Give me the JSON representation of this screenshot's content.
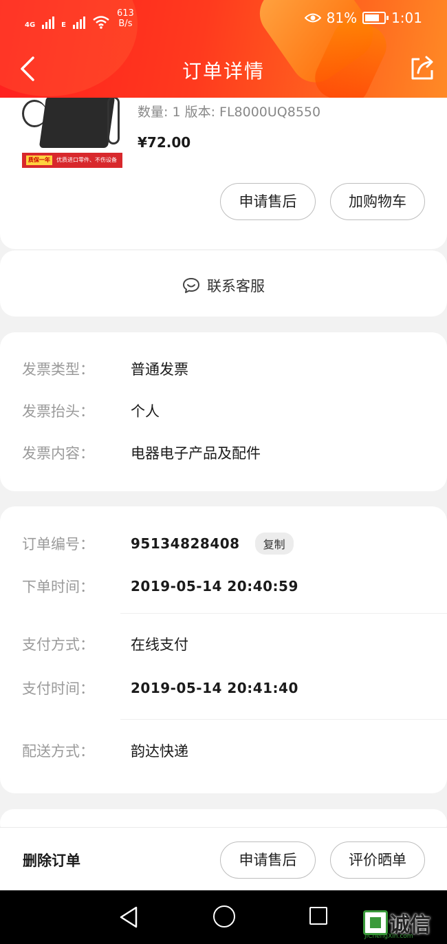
{
  "status_bar": {
    "network_1": "4G",
    "network_2": "E",
    "speed_value": "613",
    "speed_unit": "B/s",
    "battery": "81%",
    "time": "1:01"
  },
  "header": {
    "title": "订单详情"
  },
  "product": {
    "spec": "数量: 1  版本: FL8000UQ8550",
    "price": "¥72.00",
    "thumb_badge": "质保一年",
    "thumb_caption": "优质进口零件、不伤设备",
    "after_sale_label": "申请售后",
    "add_cart_label": "加购物车"
  },
  "service": {
    "label": "联系客服"
  },
  "invoice": {
    "type_label": "发票类型：",
    "type_value": "普通发票",
    "title_label": "发票抬头：",
    "title_value": "个人",
    "content_label": "发票内容：",
    "content_value": "电器电子产品及配件"
  },
  "order": {
    "number_label": "订单编号：",
    "number_value": "95134828408",
    "copy_label": "复制",
    "time_label": "下单时间：",
    "time_value": "2019-05-14 20:40:59",
    "pay_method_label": "支付方式：",
    "pay_method_value": "在线支付",
    "pay_time_label": "支付时间：",
    "pay_time_value": "2019-05-14 20:41:40",
    "delivery_label": "配送方式：",
    "delivery_value": "韵达快递"
  },
  "action_bar": {
    "delete_label": "删除订单",
    "after_sale_label": "申请售后",
    "review_label": "评价晒单"
  },
  "watermark": {
    "text": "诚信",
    "sub": "JiChengXin.com"
  },
  "colors": {
    "header_start": "#ff1f1f",
    "header_end": "#ff8a26",
    "card": "#ffffff",
    "page_bg": "#f2f2f2",
    "label_gray": "#9a9a9a"
  }
}
